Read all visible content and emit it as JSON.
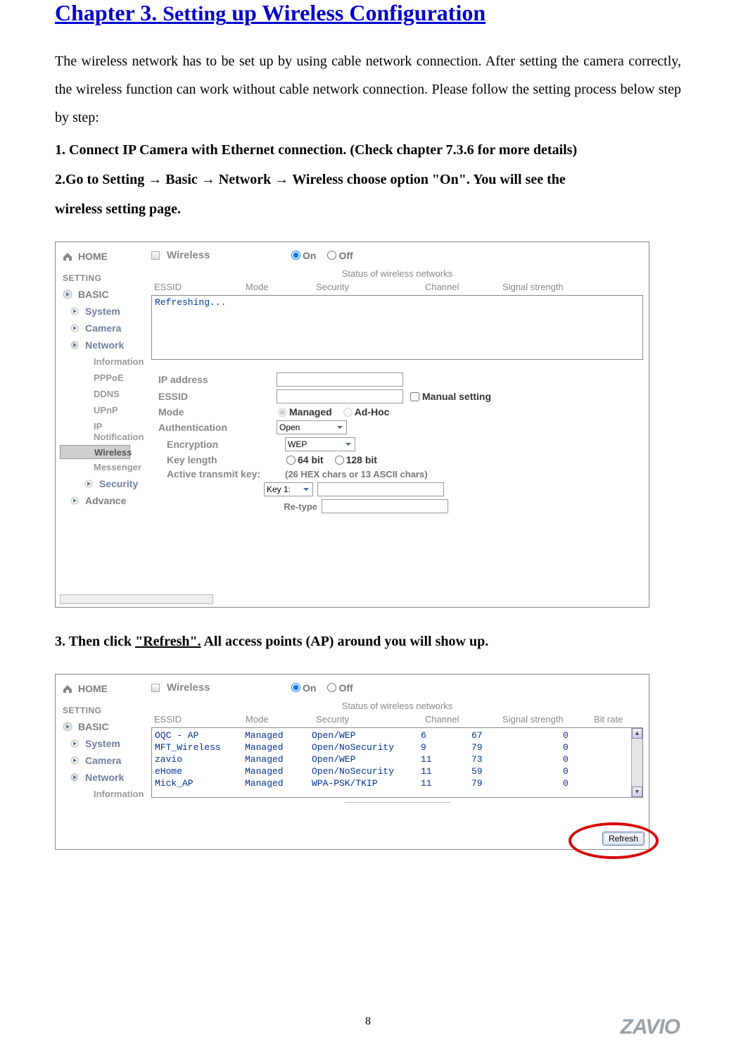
{
  "chapter": {
    "title_a": "Chapter 3.",
    "title_b": "Setting",
    "title_c": "up Wireless Configuration"
  },
  "intro": "The wireless network has to be set up by using cable network connection. After setting the camera correctly, the wireless function can work without cable network connection. Please follow the setting process below step by step:",
  "steps": {
    "s1": "1. Connect IP Camera with Ethernet connection. (Check chapter 7.3.6 for more details)",
    "s2a": "2.Go to Setting",
    "s2b": "Basic",
    "s2c": "Network",
    "s2d": "Wireless choose option \"On\". You will see the",
    "s2e": "wireless setting page.",
    "s3a": "3. Then click ",
    "s3b": "\"Refresh\".",
    "s3c": " All access points (AP) around you will show up."
  },
  "sidebar": {
    "home": "HOME",
    "setting": "SETTING",
    "basic": "BASIC",
    "items": [
      "System",
      "Camera",
      "Network"
    ],
    "netitems": [
      "Information",
      "PPPoE",
      "DDNS",
      "UPnP",
      "IP Notification",
      "Wireless",
      "Messenger"
    ],
    "security": "Security",
    "advance": "Advance"
  },
  "panel": {
    "wireless": "Wireless",
    "on": "On",
    "off": "Off",
    "status_title": "Status of wireless networks",
    "cols": {
      "essid": "ESSID",
      "mode": "Mode",
      "security": "Security",
      "channel": "Channel",
      "signal": "Signal strength",
      "bitrate": "Bit rate"
    },
    "refreshing": "Refreshing...",
    "ip": "IP address",
    "essid": "ESSID",
    "manual": "Manual setting",
    "mode": "Mode",
    "managed": "Managed",
    "adhoc": "Ad-Hoc",
    "auth": "Authentication",
    "auth_val": "Open",
    "enc": "Encryption",
    "enc_val": "WEP",
    "keylen": "Key length",
    "k64": "64 bit",
    "k128": "128 bit",
    "activekey": "Active transmit key:",
    "hexhint": "(26 HEX chars or 13 ASCII chars)",
    "key1": "Key 1:",
    "retype": "Re-type",
    "refresh_btn": "Refresh"
  },
  "networks": [
    {
      "essid": "OQC - AP",
      "mode": "Managed",
      "sec": "Open/WEP",
      "ch": "6",
      "sig": "67",
      "br": "0"
    },
    {
      "essid": "MFT_Wireless",
      "mode": "Managed",
      "sec": "Open/NoSecurity",
      "ch": "9",
      "sig": "79",
      "br": "0"
    },
    {
      "essid": "zavio",
      "mode": "Managed",
      "sec": "Open/WEP",
      "ch": "11",
      "sig": "73",
      "br": "0"
    },
    {
      "essid": "eHome",
      "mode": "Managed",
      "sec": "Open/NoSecurity",
      "ch": "11",
      "sig": "59",
      "br": "0"
    },
    {
      "essid": "Mick_AP",
      "mode": "Managed",
      "sec": "WPA-PSK/TKIP",
      "ch": "11",
      "sig": "79",
      "br": "0"
    }
  ],
  "page_number": "8",
  "logo": "ZAVIO"
}
